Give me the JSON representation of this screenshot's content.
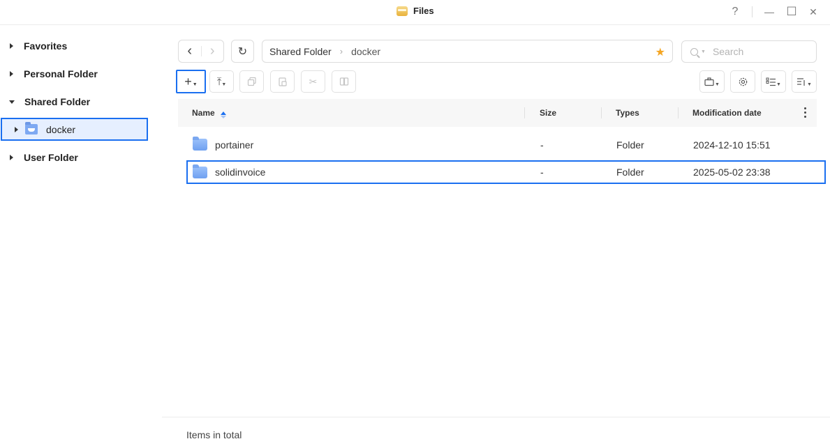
{
  "window": {
    "title": "Files",
    "help_icon": "?",
    "minimize_icon": "—",
    "maximize_icon": "☐",
    "close_icon": "✕"
  },
  "sidebar": {
    "items": [
      {
        "label": "Favorites",
        "expanded": false
      },
      {
        "label": "Personal Folder",
        "expanded": false
      },
      {
        "label": "Shared Folder",
        "expanded": true
      },
      {
        "label": "User Folder",
        "expanded": false
      }
    ],
    "selected_child": {
      "label": "docker"
    }
  },
  "toolbar": {
    "back_icon": "‹",
    "forward_icon": "›",
    "refresh_icon": "↻",
    "add_icon": "+",
    "upload_icon": "⤒"
  },
  "breadcrumb": {
    "parts": [
      "Shared Folder",
      "docker"
    ],
    "separator": "›",
    "favorite_icon": "★"
  },
  "search": {
    "placeholder": "Search"
  },
  "table": {
    "columns": [
      "Name",
      "Size",
      "Types",
      "Modification date"
    ],
    "rows": [
      {
        "name": "portainer",
        "size": "-",
        "type": "Folder",
        "modified": "2024-12-10 15:51"
      },
      {
        "name": "solidinvoice",
        "size": "-",
        "type": "Folder",
        "modified": "2025-05-02 23:38"
      }
    ],
    "selected_row": "solidinvoice"
  },
  "status": {
    "label": "Items in total"
  },
  "colors": {
    "accent": "#1a6ff0",
    "selection_bg": "#e6efff",
    "star": "#f4a522",
    "folder": "#7ea9f2"
  }
}
